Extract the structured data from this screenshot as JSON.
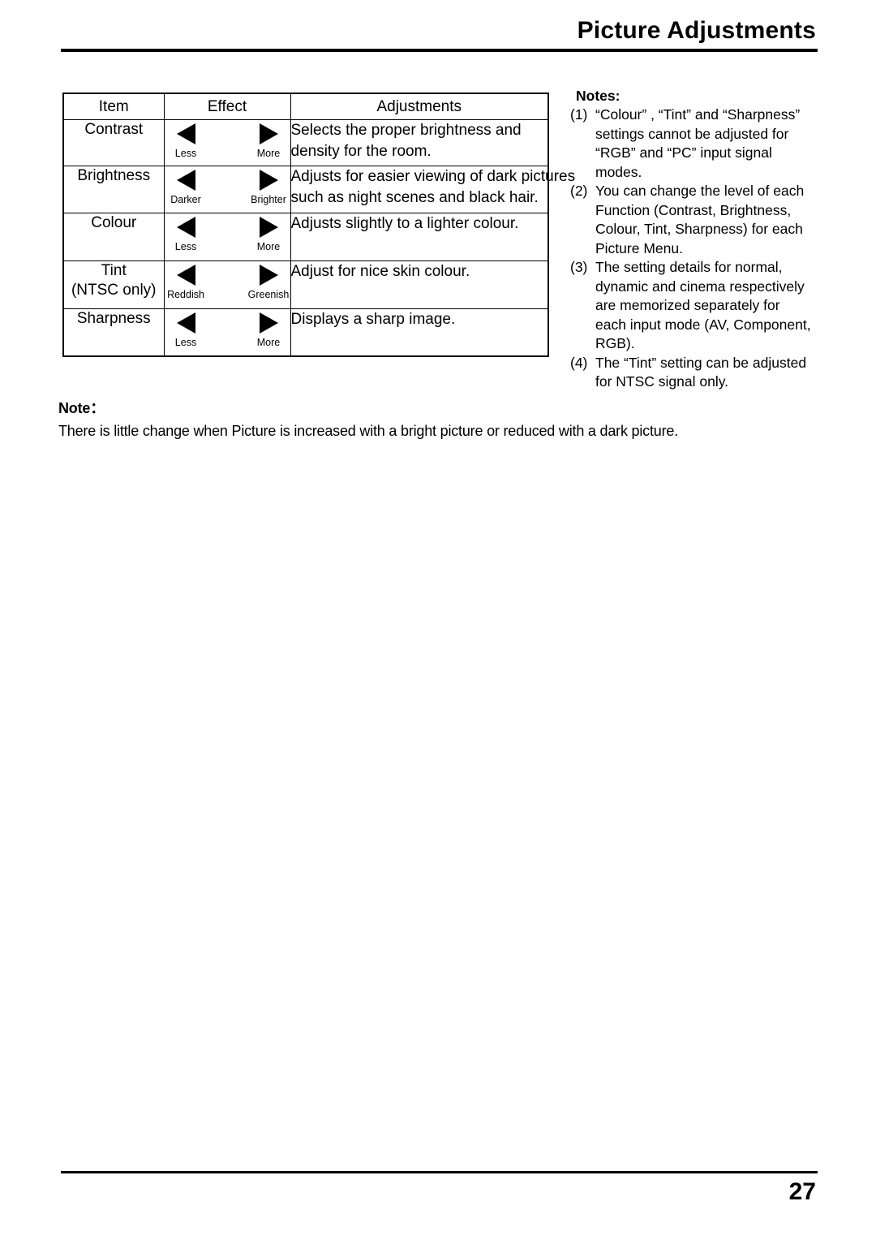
{
  "header": {
    "title": "Picture Adjustments"
  },
  "table": {
    "columns": [
      "Item",
      "Effect",
      "Adjustments"
    ],
    "rows": [
      {
        "item": "Contrast",
        "item_sub": "",
        "left_label": "Less",
        "right_label": "More",
        "adjustment_lines": [
          "Selects the proper brightness and",
          "density for the room."
        ]
      },
      {
        "item": "Brightness",
        "item_sub": "",
        "left_label": "Darker",
        "right_label": "Brighter",
        "adjustment_lines": [
          "Adjusts for easier viewing of dark pictures",
          "such as night scenes and black hair."
        ]
      },
      {
        "item": "Colour",
        "item_sub": "",
        "left_label": "Less",
        "right_label": "More",
        "adjustment_lines": [
          "Adjusts slightly to a lighter colour."
        ]
      },
      {
        "item": "Tint",
        "item_sub": "(NTSC only)",
        "left_label": "Reddish",
        "right_label": "Greenish",
        "adjustment_lines": [
          "Adjust for nice skin colour."
        ]
      },
      {
        "item": "Sharpness",
        "item_sub": "",
        "left_label": "Less",
        "right_label": "More",
        "adjustment_lines": [
          "Displays a sharp image."
        ]
      }
    ]
  },
  "notes": {
    "heading": "Notes:",
    "items": [
      {
        "marker": "(1)",
        "lines": [
          "“Colour” , “Tint” and “Sharpness”",
          "settings cannot be adjusted for",
          "“RGB” and “PC” input signal",
          "modes."
        ]
      },
      {
        "marker": "(2)",
        "lines": [
          "You can change the level of each",
          "Function (Contrast, Brightness,",
          "Colour, Tint, Sharpness) for each",
          "Picture Menu."
        ]
      },
      {
        "marker": "(3)",
        "lines": [
          "The setting details for normal,",
          "dynamic and cinema respectively",
          "are memorized separately for",
          "each input mode (AV, Component,",
          "RGB)."
        ]
      },
      {
        "marker": "(4)",
        "lines": [
          "The “Tint” setting can be adjusted",
          "for NTSC signal only."
        ]
      }
    ]
  },
  "bottom_note": {
    "heading": "Note：",
    "text": "There is little change when Picture is increased with a bright picture or reduced with a dark picture."
  },
  "footer": {
    "page_number": "27"
  },
  "icons": {
    "left_triangle": "triangle-left-icon",
    "right_triangle": "triangle-right-icon"
  }
}
